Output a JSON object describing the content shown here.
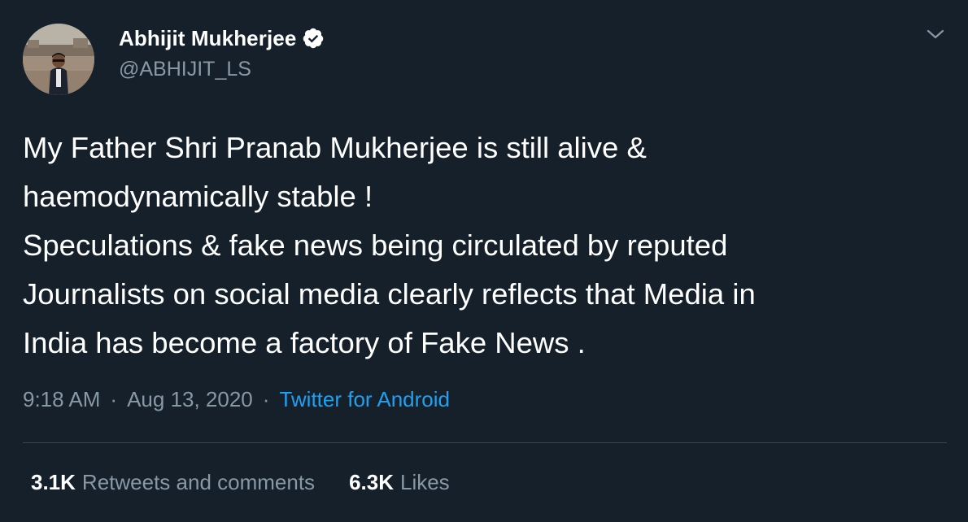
{
  "author": {
    "display_name": "Abhijit Mukherjee",
    "handle": "@ABHIJIT_LS",
    "verified": true
  },
  "tweet": {
    "text": "My Father Shri Pranab Mukherjee is still alive &\nhaemodynamically stable !\nSpeculations & fake news being circulated by reputed\nJournalists on social media clearly reflects that Media in\nIndia has become a factory of Fake News ."
  },
  "meta": {
    "time": "9:18 AM",
    "separator": "·",
    "date": "Aug 13, 2020",
    "source": "Twitter for Android"
  },
  "stats": {
    "retweets_count": "3.1K",
    "retweets_label": "Retweets and comments",
    "likes_count": "6.3K",
    "likes_label": "Likes"
  },
  "icons": {
    "verified": "verified-badge-icon",
    "menu": "chevron-down-icon"
  },
  "colors": {
    "background": "#15202b",
    "text_primary": "#ffffff",
    "text_secondary": "#8899a6",
    "link": "#1da1f2",
    "divider": "#38444d"
  }
}
